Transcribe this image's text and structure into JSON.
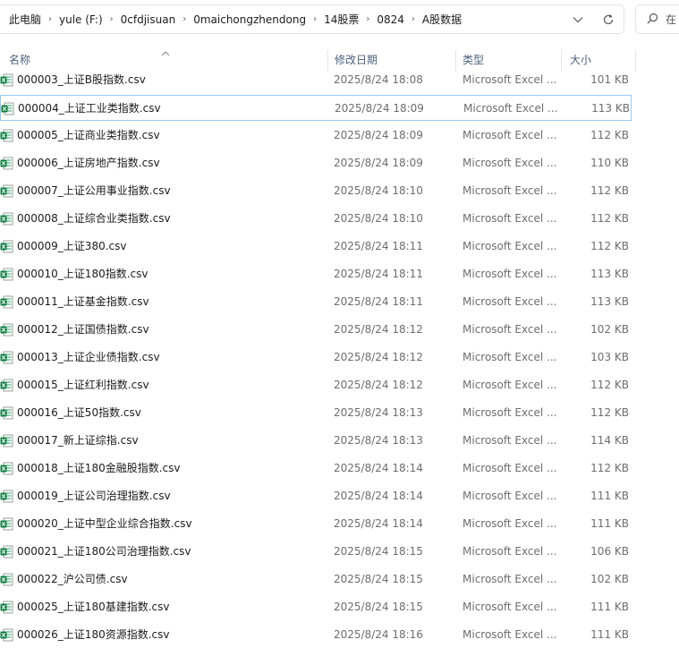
{
  "address": {
    "crumbs": [
      "此电脑",
      "yule (F:)",
      "0cfdjisuan",
      "0maichongzhendong",
      "14股票",
      "0824",
      "A股数据"
    ],
    "separator": "›"
  },
  "search": {
    "placeholder": "在"
  },
  "columns": {
    "name": "名称",
    "date": "修改日期",
    "type": "类型",
    "size": "大小"
  },
  "files": [
    {
      "name": "000003_上证B股指数.csv",
      "date": "2025/8/24 18:08",
      "type": "Microsoft Excel ...",
      "size": "101 KB"
    },
    {
      "name": "000004_上证工业类指数.csv",
      "date": "2025/8/24 18:09",
      "type": "Microsoft Excel ...",
      "size": "113 KB",
      "selected": true
    },
    {
      "name": "000005_上证商业类指数.csv",
      "date": "2025/8/24 18:09",
      "type": "Microsoft Excel ...",
      "size": "112 KB"
    },
    {
      "name": "000006_上证房地产指数.csv",
      "date": "2025/8/24 18:09",
      "type": "Microsoft Excel ...",
      "size": "110 KB"
    },
    {
      "name": "000007_上证公用事业指数.csv",
      "date": "2025/8/24 18:10",
      "type": "Microsoft Excel ...",
      "size": "112 KB"
    },
    {
      "name": "000008_上证综合业类指数.csv",
      "date": "2025/8/24 18:10",
      "type": "Microsoft Excel ...",
      "size": "112 KB"
    },
    {
      "name": "000009_上证380.csv",
      "date": "2025/8/24 18:11",
      "type": "Microsoft Excel ...",
      "size": "112 KB"
    },
    {
      "name": "000010_上证180指数.csv",
      "date": "2025/8/24 18:11",
      "type": "Microsoft Excel ...",
      "size": "113 KB"
    },
    {
      "name": "000011_上证基金指数.csv",
      "date": "2025/8/24 18:11",
      "type": "Microsoft Excel ...",
      "size": "113 KB"
    },
    {
      "name": "000012_上证国债指数.csv",
      "date": "2025/8/24 18:12",
      "type": "Microsoft Excel ...",
      "size": "102 KB"
    },
    {
      "name": "000013_上证企业债指数.csv",
      "date": "2025/8/24 18:12",
      "type": "Microsoft Excel ...",
      "size": "103 KB"
    },
    {
      "name": "000015_上证红利指数.csv",
      "date": "2025/8/24 18:12",
      "type": "Microsoft Excel ...",
      "size": "112 KB"
    },
    {
      "name": "000016_上证50指数.csv",
      "date": "2025/8/24 18:13",
      "type": "Microsoft Excel ...",
      "size": "112 KB"
    },
    {
      "name": "000017_新上证综指.csv",
      "date": "2025/8/24 18:13",
      "type": "Microsoft Excel ...",
      "size": "114 KB"
    },
    {
      "name": "000018_上证180金融股指数.csv",
      "date": "2025/8/24 18:14",
      "type": "Microsoft Excel ...",
      "size": "112 KB"
    },
    {
      "name": "000019_上证公司治理指数.csv",
      "date": "2025/8/24 18:14",
      "type": "Microsoft Excel ...",
      "size": "111 KB"
    },
    {
      "name": "000020_上证中型企业综合指数.csv",
      "date": "2025/8/24 18:14",
      "type": "Microsoft Excel ...",
      "size": "111 KB"
    },
    {
      "name": "000021_上证180公司治理指数.csv",
      "date": "2025/8/24 18:15",
      "type": "Microsoft Excel ...",
      "size": "106 KB"
    },
    {
      "name": "000022_沪公司债.csv",
      "date": "2025/8/24 18:15",
      "type": "Microsoft Excel ...",
      "size": "102 KB"
    },
    {
      "name": "000025_上证180基建指数.csv",
      "date": "2025/8/24 18:15",
      "type": "Microsoft Excel ...",
      "size": "111 KB"
    },
    {
      "name": "000026_上证180资源指数.csv",
      "date": "2025/8/24 18:16",
      "type": "Microsoft Excel ...",
      "size": "111 KB"
    }
  ],
  "colors": {
    "excel_green": "#107c41",
    "selection_border": "#99c9ef",
    "header_text": "#4c607a"
  }
}
